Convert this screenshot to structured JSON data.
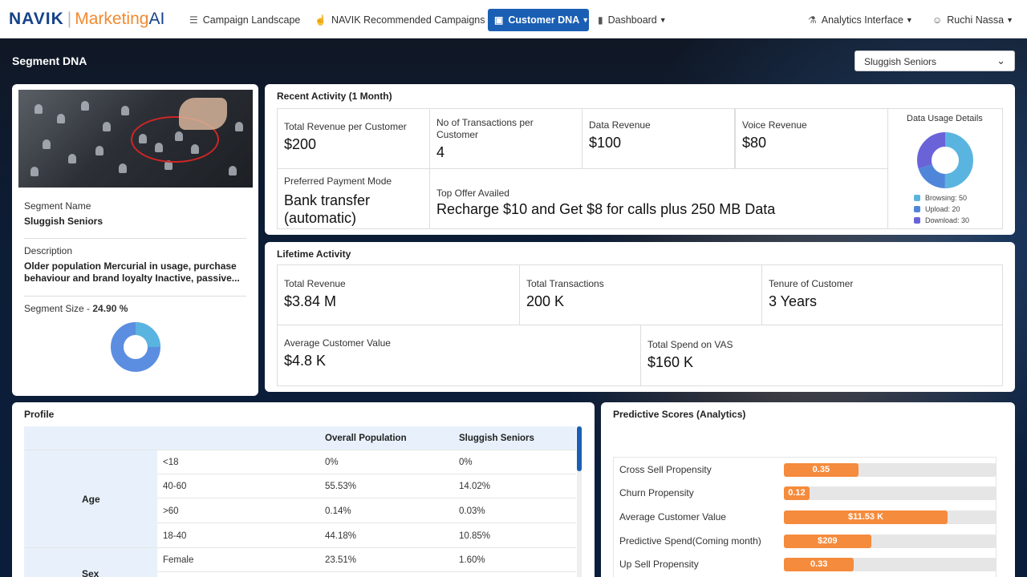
{
  "header": {
    "logo": {
      "brand": "NAVIK",
      "sep": "|",
      "product": "Marketing",
      "suffix": "AI"
    },
    "nav": [
      {
        "label": "Campaign Landscape",
        "icon": "list-icon"
      },
      {
        "label": "NAVIK Recommended Campaigns",
        "icon": "hand-pointer-icon"
      },
      {
        "label": "Customer DNA",
        "icon": "window-icon",
        "active": true
      },
      {
        "label": "Dashboard",
        "icon": "bar-chart-icon"
      }
    ],
    "analytics_label": "Analytics Interface",
    "user_name": "Ruchi Nassa"
  },
  "page": {
    "title": "Segment DNA",
    "segment_select": "Sluggish Seniors"
  },
  "segment": {
    "name_label": "Segment Name",
    "name": "Sluggish Seniors",
    "desc_label": "Description",
    "desc": "Older population Mercurial in usage, purchase behaviour and brand loyalty Inactive, passive...",
    "size_label": "Segment Size - ",
    "size_value": "24.90 %",
    "size_fraction": 0.249
  },
  "recent": {
    "title": "Recent Activity (1 Month)",
    "cells": [
      {
        "label": "Total Revenue per Customer",
        "value": "$200"
      },
      {
        "label": "No of Transactions per Customer",
        "value": "4"
      },
      {
        "label": "Data Revenue",
        "value": "$100"
      },
      {
        "label": "Voice Revenue",
        "value": "$80"
      },
      {
        "label": "Preferred Payment Mode",
        "value": "Bank transfer (automatic)"
      },
      {
        "label": "Top Offer Availed",
        "value": "Recharge $10 and Get $8 for calls plus 250 MB Data"
      }
    ],
    "usage": {
      "title": "Data Usage Details",
      "items": [
        {
          "label": "Browsing: 50",
          "value": 50,
          "color": "#5ab4e0"
        },
        {
          "label": "Upload: 20",
          "value": 20,
          "color": "#4f86d9"
        },
        {
          "label": "Download: 30",
          "value": 30,
          "color": "#6a63d8"
        }
      ]
    }
  },
  "lifetime": {
    "title": "Lifetime Activity",
    "cells": [
      {
        "label": "Total Revenue",
        "value": "$3.84 M"
      },
      {
        "label": "Total Transactions",
        "value": "200 K"
      },
      {
        "label": "Tenure of Customer",
        "value": "3 Years"
      },
      {
        "label": "Average Customer Value",
        "value": "$4.8 K"
      },
      {
        "label": "Total Spend on VAS",
        "value": "$160 K"
      }
    ]
  },
  "profile": {
    "title": "Profile",
    "headers": [
      "Overall Population",
      "Sluggish Seniors"
    ],
    "groups": [
      {
        "name": "Age",
        "rows": [
          {
            "cat": "<18",
            "overall": "0%",
            "segment": "0%"
          },
          {
            "cat": "40-60",
            "overall": "55.53%",
            "segment": "14.02%"
          },
          {
            "cat": ">60",
            "overall": "0.14%",
            "segment": "0.03%"
          },
          {
            "cat": "18-40",
            "overall": "44.18%",
            "segment": "10.85%"
          }
        ]
      },
      {
        "name": "Sex",
        "rows": [
          {
            "cat": "Female",
            "overall": "23.51%",
            "segment": "1.60%"
          }
        ]
      }
    ]
  },
  "predictive": {
    "title": "Predictive Scores (Analytics)",
    "rows": [
      {
        "label": "Cross Sell Propensity",
        "value": "0.35",
        "fill": 0.35
      },
      {
        "label": "Churn Propensity",
        "value": "0.12",
        "fill": 0.12
      },
      {
        "label": "Average Customer Value",
        "value": "$11.53 K",
        "fill": 0.77
      },
      {
        "label": "Predictive Spend(Coming month)",
        "value": "$209",
        "fill": 0.41
      },
      {
        "label": "Up Sell Propensity",
        "value": "0.33",
        "fill": 0.33
      }
    ]
  }
}
